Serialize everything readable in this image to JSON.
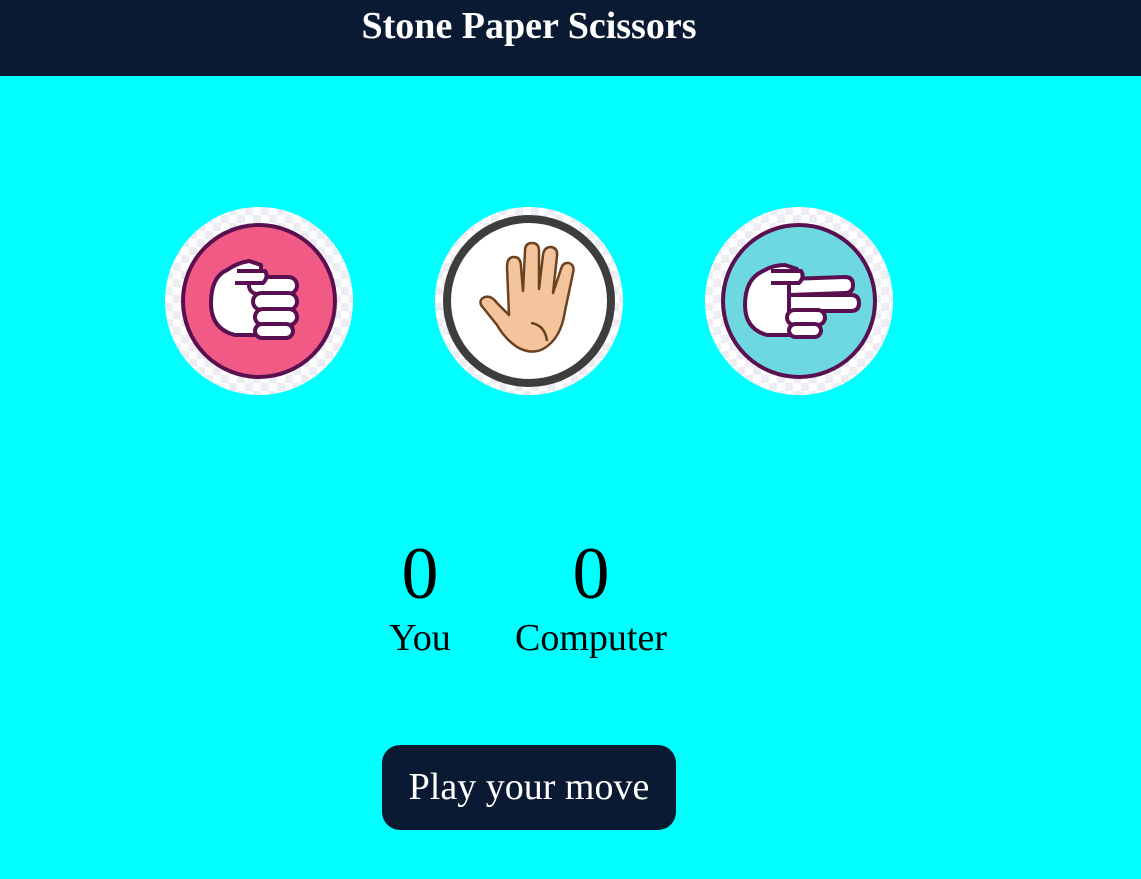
{
  "header": {
    "title": "Stone Paper Scissors",
    "background": "#0a1a33"
  },
  "page": {
    "background": "#00ffff"
  },
  "choices": [
    {
      "id": "stone",
      "icon": "fist-icon",
      "color": "#f05a85"
    },
    {
      "id": "paper",
      "icon": "open-hand-icon",
      "color": "#ffffff"
    },
    {
      "id": "scissors",
      "icon": "two-fingers-icon",
      "color": "#6ed8e0"
    }
  ],
  "scoreboard": {
    "you": {
      "score": "0",
      "label": "You"
    },
    "computer": {
      "score": "0",
      "label": "Computer"
    }
  },
  "actions": {
    "play_label": "Play your move"
  }
}
